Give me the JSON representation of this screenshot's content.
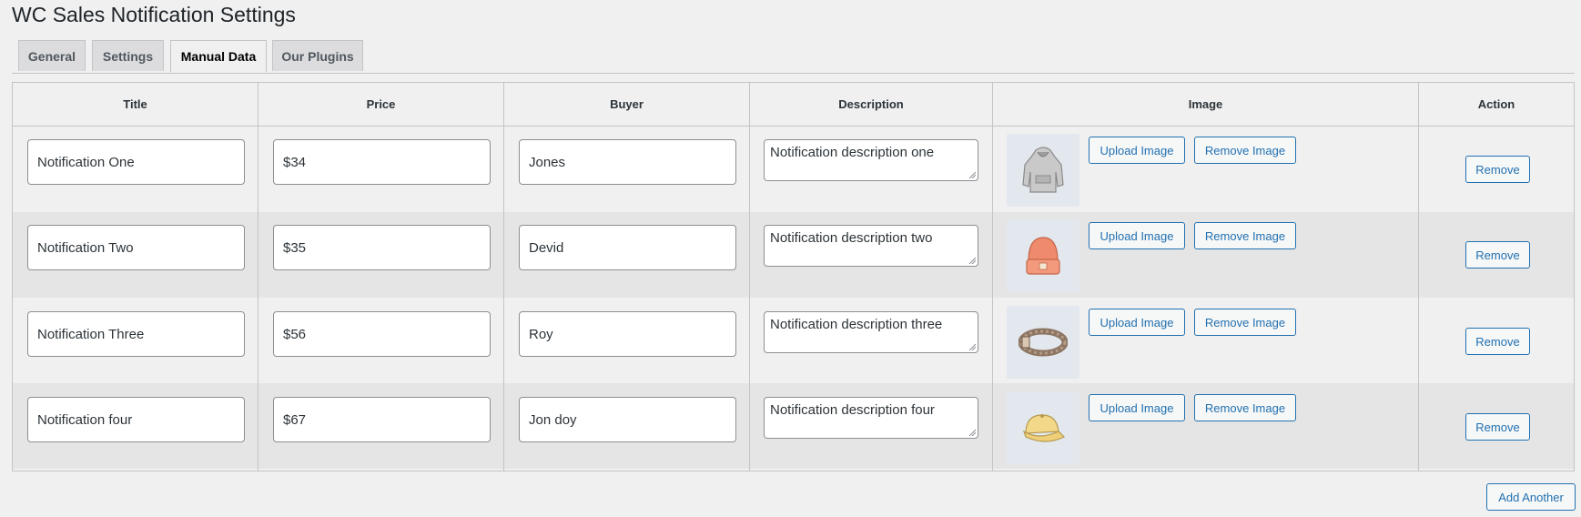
{
  "page": {
    "title": "WC Sales Notification Settings"
  },
  "tabs": [
    {
      "label": "General",
      "active": false
    },
    {
      "label": "Settings",
      "active": false
    },
    {
      "label": "Manual Data",
      "active": true
    },
    {
      "label": "Our Plugins",
      "active": false
    }
  ],
  "table": {
    "headers": {
      "title": "Title",
      "price": "Price",
      "buyer": "Buyer",
      "description": "Description",
      "image": "Image",
      "action": "Action"
    },
    "rows": [
      {
        "title": "Notification One",
        "price": "$34",
        "buyer": "Jones",
        "description": "Notification description one",
        "image_icon": "hoodie-icon"
      },
      {
        "title": "Notification Two",
        "price": "$35",
        "buyer": "Devid",
        "description": "Notification description two",
        "image_icon": "beanie-icon"
      },
      {
        "title": "Notification Three",
        "price": "$56",
        "buyer": "Roy",
        "description": "Notification description three",
        "image_icon": "belt-icon"
      },
      {
        "title": "Notification four",
        "price": "$67",
        "buyer": "Jon doy",
        "description": "Notification description four",
        "image_icon": "cap-icon"
      }
    ],
    "upload_label": "Upload Image",
    "remove_image_label": "Remove Image",
    "remove_label": "Remove"
  },
  "add_another_label": "Add Another",
  "colors": {
    "accent": "#2271b1",
    "background": "#f0f0f1",
    "row_alt": "#e5e5e5"
  }
}
